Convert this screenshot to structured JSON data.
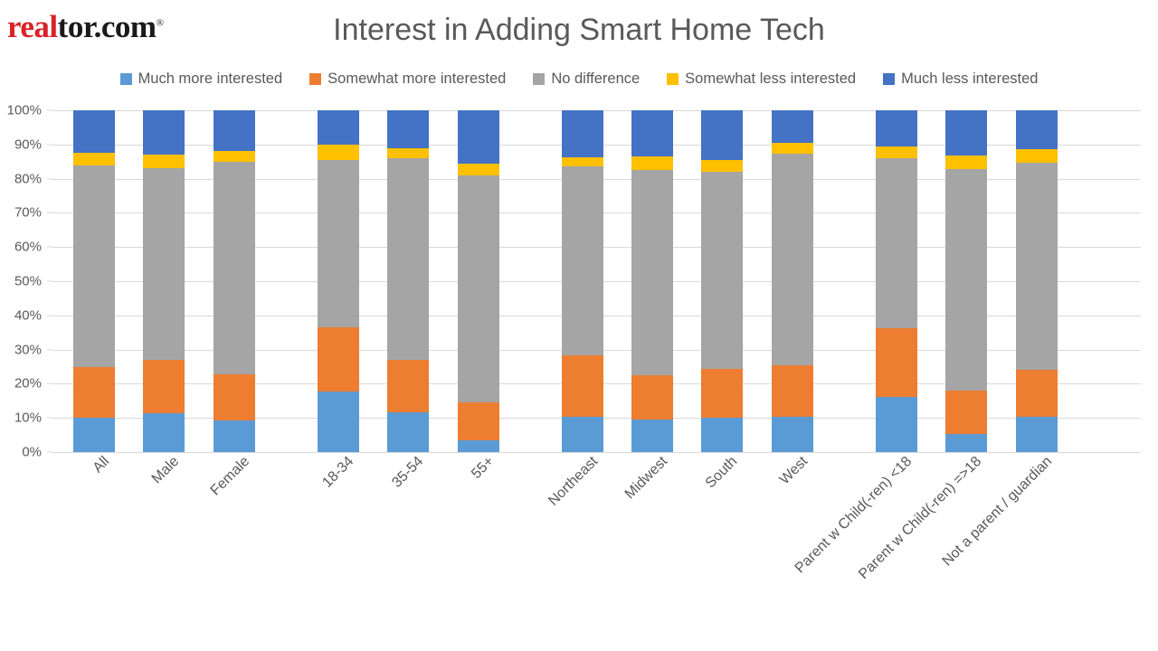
{
  "logo": {
    "part_red": "real",
    "part_dark": "tor.com",
    "registered": "®",
    "alt": "realtor.com"
  },
  "header": {
    "title": "Interest in Adding Smart Home Tech"
  },
  "colors": {
    "much_more": "#5b9bd5",
    "somewhat_more": "#ed7d31",
    "no_difference": "#a5a5a5",
    "somewhat_less": "#ffc000",
    "much_less": "#4472c4",
    "gridline": "#d9d9d9",
    "text": "#595959",
    "logo_red": "#d92228"
  },
  "legend": {
    "position": "top",
    "items": [
      {
        "label": "Much more interested",
        "color": "#5b9bd5"
      },
      {
        "label": "Somewhat more interested",
        "color": "#ed7d31"
      },
      {
        "label": "No difference",
        "color": "#a5a5a5"
      },
      {
        "label": "Somewhat less interested",
        "color": "#ffc000"
      },
      {
        "label": "Much less interested",
        "color": "#4472c4"
      }
    ]
  },
  "chart_data": {
    "type": "bar",
    "stacked": true,
    "orientation": "vertical",
    "title": "Interest in Adding Smart Home Tech",
    "xlabel": "",
    "ylabel": "",
    "ylim": [
      0,
      100
    ],
    "ytick_labels": [
      "0%",
      "10%",
      "20%",
      "30%",
      "40%",
      "50%",
      "60%",
      "70%",
      "80%",
      "90%",
      "100%"
    ],
    "ytick_values": [
      0,
      10,
      20,
      30,
      40,
      50,
      60,
      70,
      80,
      90,
      100
    ],
    "grid": true,
    "units": "percent",
    "categories": [
      "All",
      "Male",
      "Female",
      "18-34",
      "35-54",
      "55+",
      "Northeast",
      "Midwest",
      "South",
      "West",
      "Parent w Child(-ren) <18",
      "Parent w Child(-ren) =>18",
      "Not a parent / guardian"
    ],
    "group_gaps_after": [
      "Female",
      "55+",
      "West"
    ],
    "series": [
      {
        "name": "Much more interested",
        "color": "#5b9bd5",
        "values": [
          10.0,
          11.4,
          9.3,
          17.7,
          11.6,
          3.4,
          10.3,
          9.5,
          10.1,
          10.3,
          16.2,
          5.3,
          10.3
        ]
      },
      {
        "name": "Somewhat more interested",
        "color": "#ed7d31",
        "values": [
          14.8,
          15.6,
          13.5,
          18.8,
          15.4,
          11.1,
          18.0,
          13.0,
          14.2,
          15.2,
          20.0,
          12.7,
          13.8
        ]
      },
      {
        "name": "No difference",
        "color": "#a5a5a5",
        "values": [
          59.2,
          56.0,
          62.2,
          49.0,
          59.0,
          66.5,
          55.4,
          60.0,
          57.7,
          61.8,
          49.8,
          64.8,
          60.6
        ]
      },
      {
        "name": "Somewhat less interested",
        "color": "#ffc000",
        "values": [
          3.7,
          4.0,
          3.2,
          4.5,
          3.0,
          3.5,
          2.6,
          4.0,
          3.5,
          3.2,
          3.4,
          4.0,
          3.9
        ]
      },
      {
        "name": "Much less interested",
        "color": "#4472c4",
        "values": [
          12.3,
          13.0,
          11.8,
          10.0,
          11.0,
          15.5,
          13.7,
          13.5,
          14.5,
          9.5,
          10.6,
          13.2,
          11.4
        ]
      }
    ]
  }
}
